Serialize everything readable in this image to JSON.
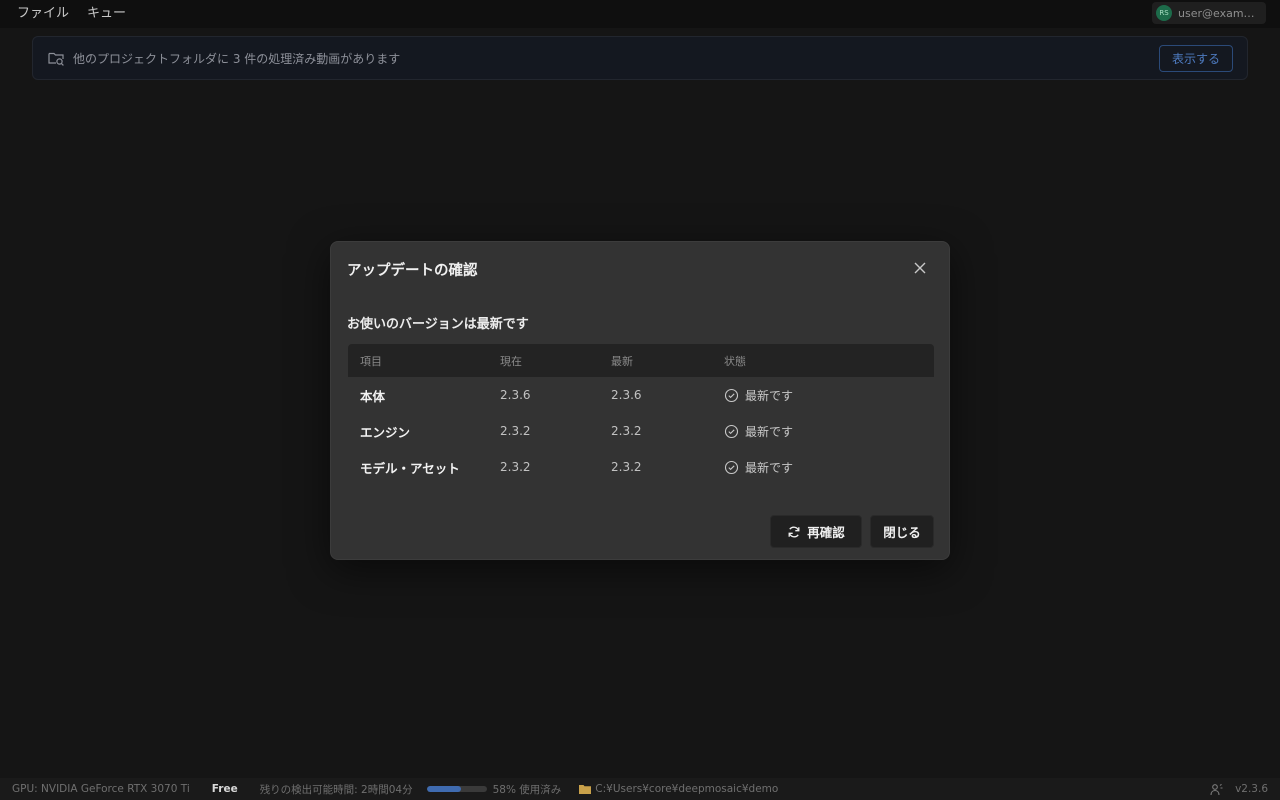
{
  "menubar": {
    "items": [
      "ファイル",
      "キュー"
    ],
    "user": {
      "initials": "RS",
      "email": "user@example...."
    }
  },
  "banner": {
    "text": "他のプロジェクトフォルダに 3 件の処理済み動画があります",
    "button_label": "表示する",
    "icon": "folder-search-icon"
  },
  "dialog": {
    "title": "アップデートの確認",
    "status_heading": "お使いのバージョンは最新です",
    "table": {
      "headers": [
        "項目",
        "現在",
        "最新",
        "状態"
      ],
      "rows": [
        {
          "name": "本体",
          "current": "2.3.6",
          "latest": "2.3.6",
          "status": "最新です"
        },
        {
          "name": "エンジン",
          "current": "2.3.2",
          "latest": "2.3.2",
          "status": "最新です"
        },
        {
          "name": "モデル・アセット",
          "current": "2.3.2",
          "latest": "2.3.2",
          "status": "最新です"
        }
      ]
    },
    "recheck_label": "再確認",
    "close_label": "閉じる"
  },
  "statusbar": {
    "gpu": "GPU: NVIDIA GeForce RTX 3070 Ti",
    "plan": "Free",
    "remaining": "残りの検出可能時間: 2時間04分",
    "usage_percent": 58,
    "usage_text": "58% 使用済み",
    "path": "C:¥Users¥core¥deepmosaic¥demo",
    "version": "v2.3.6"
  },
  "colors": {
    "accent": "#3f6bb0",
    "folder": "#c9a14a",
    "avatar": "#1d6b4a"
  }
}
